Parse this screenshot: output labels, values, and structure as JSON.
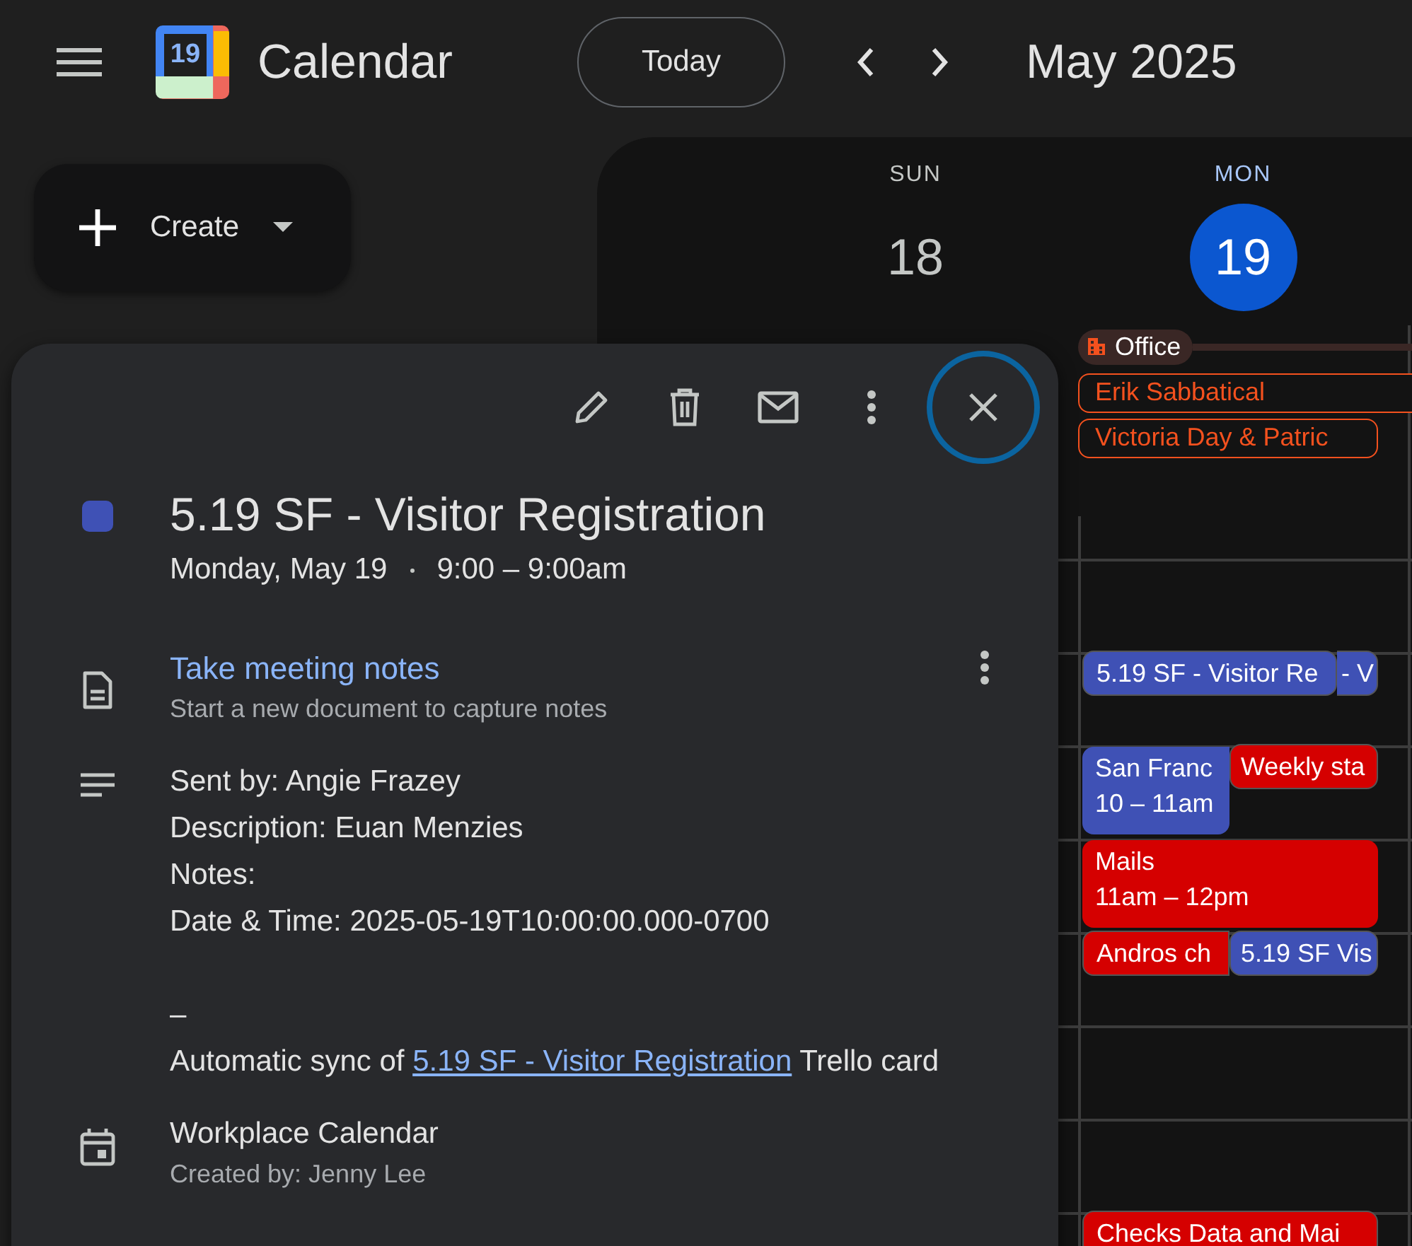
{
  "header": {
    "logo_day": "19",
    "app_name": "Calendar",
    "today_button": "Today",
    "period": "May 2025"
  },
  "create_button": {
    "label": "Create"
  },
  "days": [
    {
      "weekday": "SUN",
      "date": "18",
      "selected": false
    },
    {
      "weekday": "MON",
      "date": "19",
      "selected": true
    }
  ],
  "working_location": {
    "label": "Office"
  },
  "all_day_events": [
    {
      "title": "Erik Sabbatical",
      "color": "#f4511e",
      "kind": "full"
    },
    {
      "title": "Victoria Day & Patric",
      "color": "#f4511e",
      "kind": "short"
    }
  ],
  "hour_rows": [
    {
      "events": []
    },
    {
      "events": []
    },
    {
      "events": [
        {
          "title": "5.19 SF - Visitor Re",
          "color": "#3f51b5",
          "kind": "inset"
        },
        {
          "title": "- V",
          "color": "#3f51b5",
          "kind": "tail"
        }
      ]
    },
    {
      "events": [
        {
          "title": "San Franc",
          "time": "10 – 11am",
          "color": "#3f51b5",
          "kind": "short"
        },
        {
          "title": "Weekly sta",
          "color": "#d50000",
          "kind": "overlay"
        }
      ]
    },
    {
      "events": [
        {
          "title": "Mails",
          "time": "11am – 12pm",
          "color": "#d50000",
          "kind": "base"
        }
      ]
    },
    {
      "events": [
        {
          "title": "Andros ch",
          "color": "#d50000",
          "kind": "short"
        },
        {
          "title": "5.19 SF Vis",
          "color": "#3f51b5",
          "kind": "overlay"
        }
      ]
    },
    {
      "events": []
    },
    {
      "events": []
    },
    {
      "events": [
        {
          "title": "Checks Data and Mai",
          "color": "#d50000",
          "kind": "base"
        }
      ]
    }
  ],
  "popup": {
    "color": "#3f51b5",
    "close_focused": true,
    "title": "5.19 SF - Visitor Registration",
    "date": "Monday, May 19",
    "time": "9:00 – 9:00am",
    "notes": {
      "link": "Take meeting notes",
      "hint": "Start a new document to capture notes"
    },
    "description": [
      "Sent by: Angie Frazey",
      "Description: Euan Menzies",
      "Notes:",
      "Date & Time: 2025-05-19T10:00:00.000-0700"
    ],
    "separator": "–",
    "sync": {
      "before": "Automatic sync of",
      "link": "5.19 SF - Visitor Registration",
      "after": "Trello card"
    },
    "calendar": {
      "name": "Workplace Calendar",
      "creator": "Created by: Jenny Lee"
    }
  }
}
